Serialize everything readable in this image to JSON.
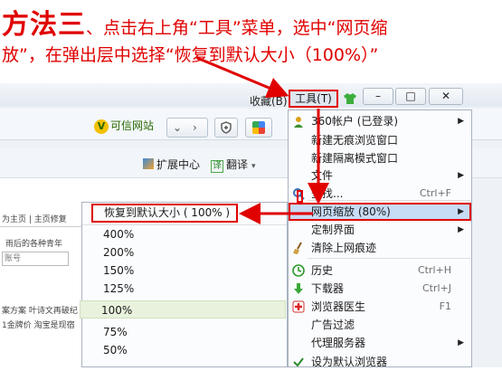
{
  "instruction": {
    "step_title": "方法三",
    "line1_text": "、点击右上角“工具”菜单，选中“网页缩",
    "line2_text": "放”，在弹出层中选择“恢复到默认大小（100%）”"
  },
  "titlebar": {
    "favorites_label": "收藏(B)",
    "tools_label": "工具(T)",
    "minimize_label": "–",
    "maximize_label": "□",
    "close_label": "✕"
  },
  "toolbar": {
    "credit_badge": "V",
    "credit_label": "可信网站",
    "extensions_label": "扩展中心",
    "translate_badge": "译",
    "translate_label": "翻译"
  },
  "page": {
    "links": "为主页 | 主页修复",
    "text1": "雨后的各种青年",
    "account_placeholder": "账号",
    "text2": "案方案 叶诗文再破纪",
    "text3": "1金牌价 淘宝是现宿"
  },
  "menu": {
    "items": [
      {
        "label": "360帐户 (已登录)",
        "shortcut": "",
        "submenu": true,
        "icon": "user-icon"
      },
      {
        "label": "新建无痕浏览窗口",
        "shortcut": "",
        "submenu": false,
        "icon": ""
      },
      {
        "label": "新建隔离模式窗口",
        "shortcut": "",
        "submenu": false,
        "icon": ""
      },
      {
        "label": "文件",
        "shortcut": "",
        "submenu": true,
        "icon": ""
      },
      {
        "label": "查找...",
        "shortcut": "Ctrl+F",
        "submenu": false,
        "icon": "search-icon"
      },
      {
        "label": "网页缩放 (80%)",
        "shortcut": "",
        "submenu": true,
        "icon": ""
      },
      {
        "label": "定制界面",
        "shortcut": "",
        "submenu": true,
        "icon": ""
      },
      {
        "label": "清除上网痕迹",
        "shortcut": "",
        "submenu": false,
        "icon": "broom-icon"
      },
      {
        "label": "历史",
        "shortcut": "Ctrl+H",
        "submenu": false,
        "icon": "history-icon"
      },
      {
        "label": "下载器",
        "shortcut": "Ctrl+J",
        "submenu": false,
        "icon": "download-icon"
      },
      {
        "label": "浏览器医生",
        "shortcut": "F1",
        "submenu": false,
        "icon": "doctor-icon"
      },
      {
        "label": "广告过滤",
        "shortcut": "",
        "submenu": false,
        "icon": ""
      },
      {
        "label": "代理服务器",
        "shortcut": "",
        "submenu": true,
        "icon": ""
      },
      {
        "label": "设为默认浏览器",
        "shortcut": "",
        "submenu": false,
        "icon": "check-icon"
      }
    ]
  },
  "zoom_submenu": {
    "reset_label": "恢复到默认大小 ( 100% )",
    "options": [
      "400%",
      "200%",
      "150%",
      "125%",
      "100%",
      "75%",
      "50%"
    ],
    "selected": "100%"
  },
  "colors": {
    "annotation": "#e00000",
    "menu_highlight": "#c7dcf5",
    "selected_zoom": "#e8f2dd"
  }
}
